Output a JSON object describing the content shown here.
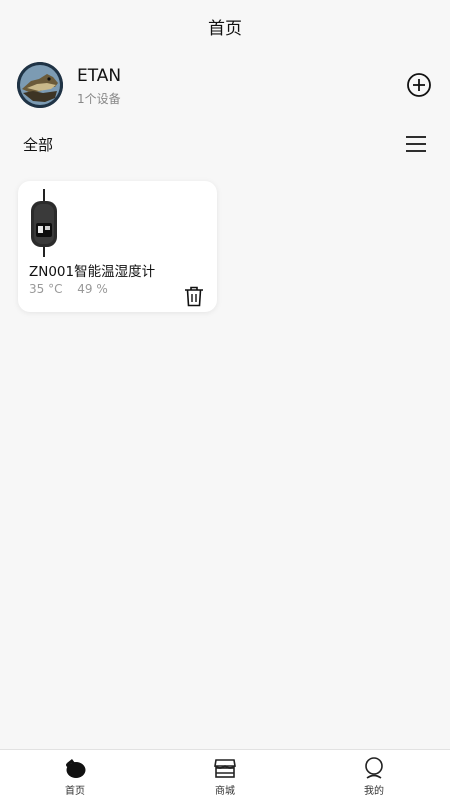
{
  "header": {
    "title": "首页"
  },
  "user": {
    "name": "ETAN",
    "device_count_text": "1个设备"
  },
  "filter": {
    "label": "全部"
  },
  "devices": [
    {
      "name": "ZN001智能温湿度计",
      "temperature": "35 °C",
      "humidity": "49 %"
    }
  ],
  "bottom_nav": [
    {
      "label": "首页",
      "icon": "home-icon",
      "active": true
    },
    {
      "label": "商城",
      "icon": "store-icon",
      "active": false
    },
    {
      "label": "我的",
      "icon": "profile-icon",
      "active": false
    }
  ],
  "colors": {
    "background": "#f7f7f7",
    "card": "#ffffff",
    "text": "#111111",
    "muted": "#999999"
  }
}
